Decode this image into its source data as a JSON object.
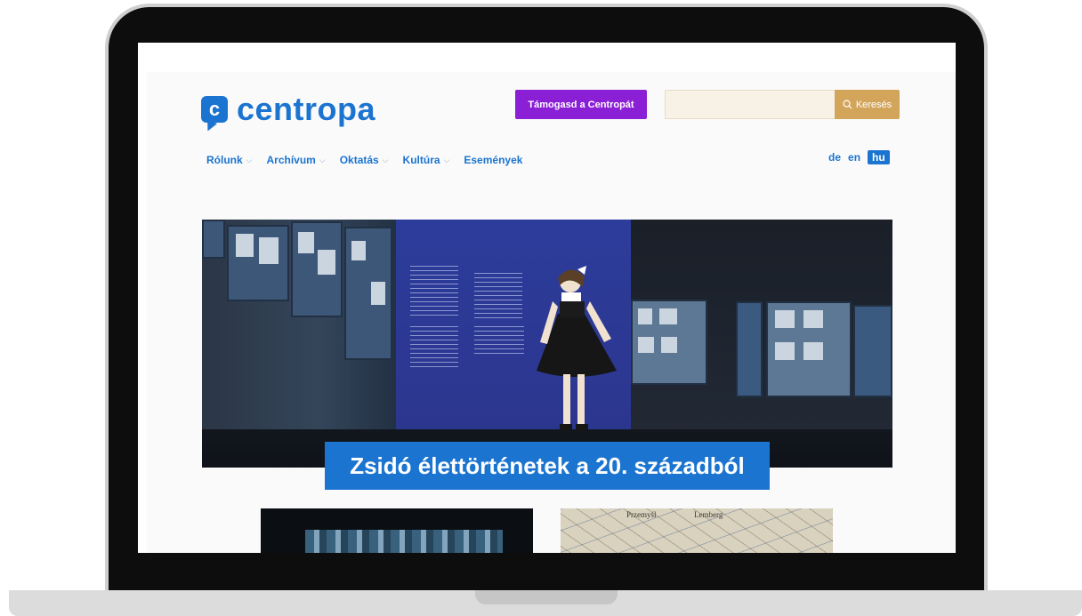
{
  "brand": {
    "logo_letter": "c",
    "name": "centropa",
    "color": "#1b74d0"
  },
  "header": {
    "support_button": "Támogasd a Centropát",
    "support_color": "#8a1fd6",
    "search_placeholder": "",
    "search_button": "Keresés",
    "search_icon": "search-icon",
    "search_color": "#d3a55b"
  },
  "nav": {
    "items": [
      {
        "label": "Rólunk",
        "dropdown": true
      },
      {
        "label": "Archívum",
        "dropdown": true
      },
      {
        "label": "Oktatás",
        "dropdown": true
      },
      {
        "label": "Kultúra",
        "dropdown": true
      },
      {
        "label": "Események",
        "dropdown": false
      }
    ],
    "chevron": "⌵"
  },
  "languages": {
    "items": [
      "de",
      "en",
      "hu"
    ],
    "active": "hu"
  },
  "hero": {
    "caption": "Zsidó élettörténetek a 20. századból"
  },
  "thumbnails": {
    "map_labels": [
      "Przemyśl",
      "Lemberg"
    ]
  }
}
